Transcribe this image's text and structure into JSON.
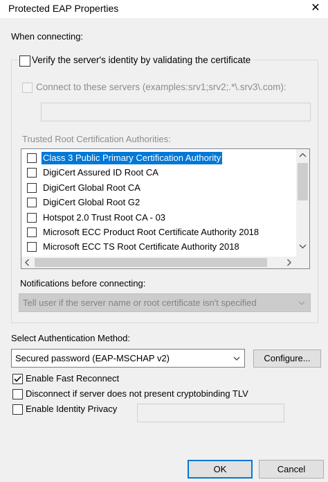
{
  "window": {
    "title": "Protected EAP Properties",
    "close_glyph": "✕"
  },
  "when_connecting": {
    "label": "When connecting:",
    "verify_label": "Verify the server's identity by validating the certificate",
    "verify_checked": false,
    "connect_label": "Connect to these servers (examples:srv1;srv2;.*\\.srv3\\.com):",
    "connect_checked": false,
    "servers_value": "",
    "trusted_label": "Trusted Root Certification Authorities:",
    "cas": [
      {
        "label": "Class 3 Public Primary Certification Authority",
        "checked": false,
        "selected": true
      },
      {
        "label": "DigiCert Assured ID Root CA",
        "checked": false,
        "selected": false
      },
      {
        "label": "DigiCert Global Root CA",
        "checked": false,
        "selected": false
      },
      {
        "label": "DigiCert Global Root G2",
        "checked": false,
        "selected": false
      },
      {
        "label": "Hotspot 2.0 Trust Root CA - 03",
        "checked": false,
        "selected": false
      },
      {
        "label": "Microsoft ECC Product Root Certificate Authority 2018",
        "checked": false,
        "selected": false
      },
      {
        "label": "Microsoft ECC TS Root Certificate Authority 2018",
        "checked": false,
        "selected": false
      }
    ],
    "notifications_label": "Notifications before connecting:",
    "notifications_value": "Tell user if the server name or root certificate isn't specified"
  },
  "auth": {
    "label": "Select Authentication Method:",
    "method_value": "Secured password (EAP-MSCHAP v2)",
    "configure_label": "Configure..."
  },
  "options": {
    "fast_reconnect_label": "Enable Fast Reconnect",
    "fast_reconnect_checked": true,
    "disconnect_label": "Disconnect if server does not present cryptobinding TLV",
    "disconnect_checked": false,
    "identity_privacy_label": "Enable Identity Privacy",
    "identity_privacy_checked": false,
    "identity_value": ""
  },
  "buttons": {
    "ok_label": "OK",
    "cancel_label": "Cancel"
  },
  "icons": {
    "close": "close-icon",
    "checkmark": "checkmark-icon",
    "scroll_up": "chevron-up-icon",
    "scroll_down": "chevron-down-icon",
    "scroll_left": "chevron-left-icon",
    "scroll_right": "chevron-right-icon",
    "dropdown": "chevron-down-icon"
  },
  "colors": {
    "selection": "#0078d7",
    "default_button_border": "#0078d7"
  }
}
